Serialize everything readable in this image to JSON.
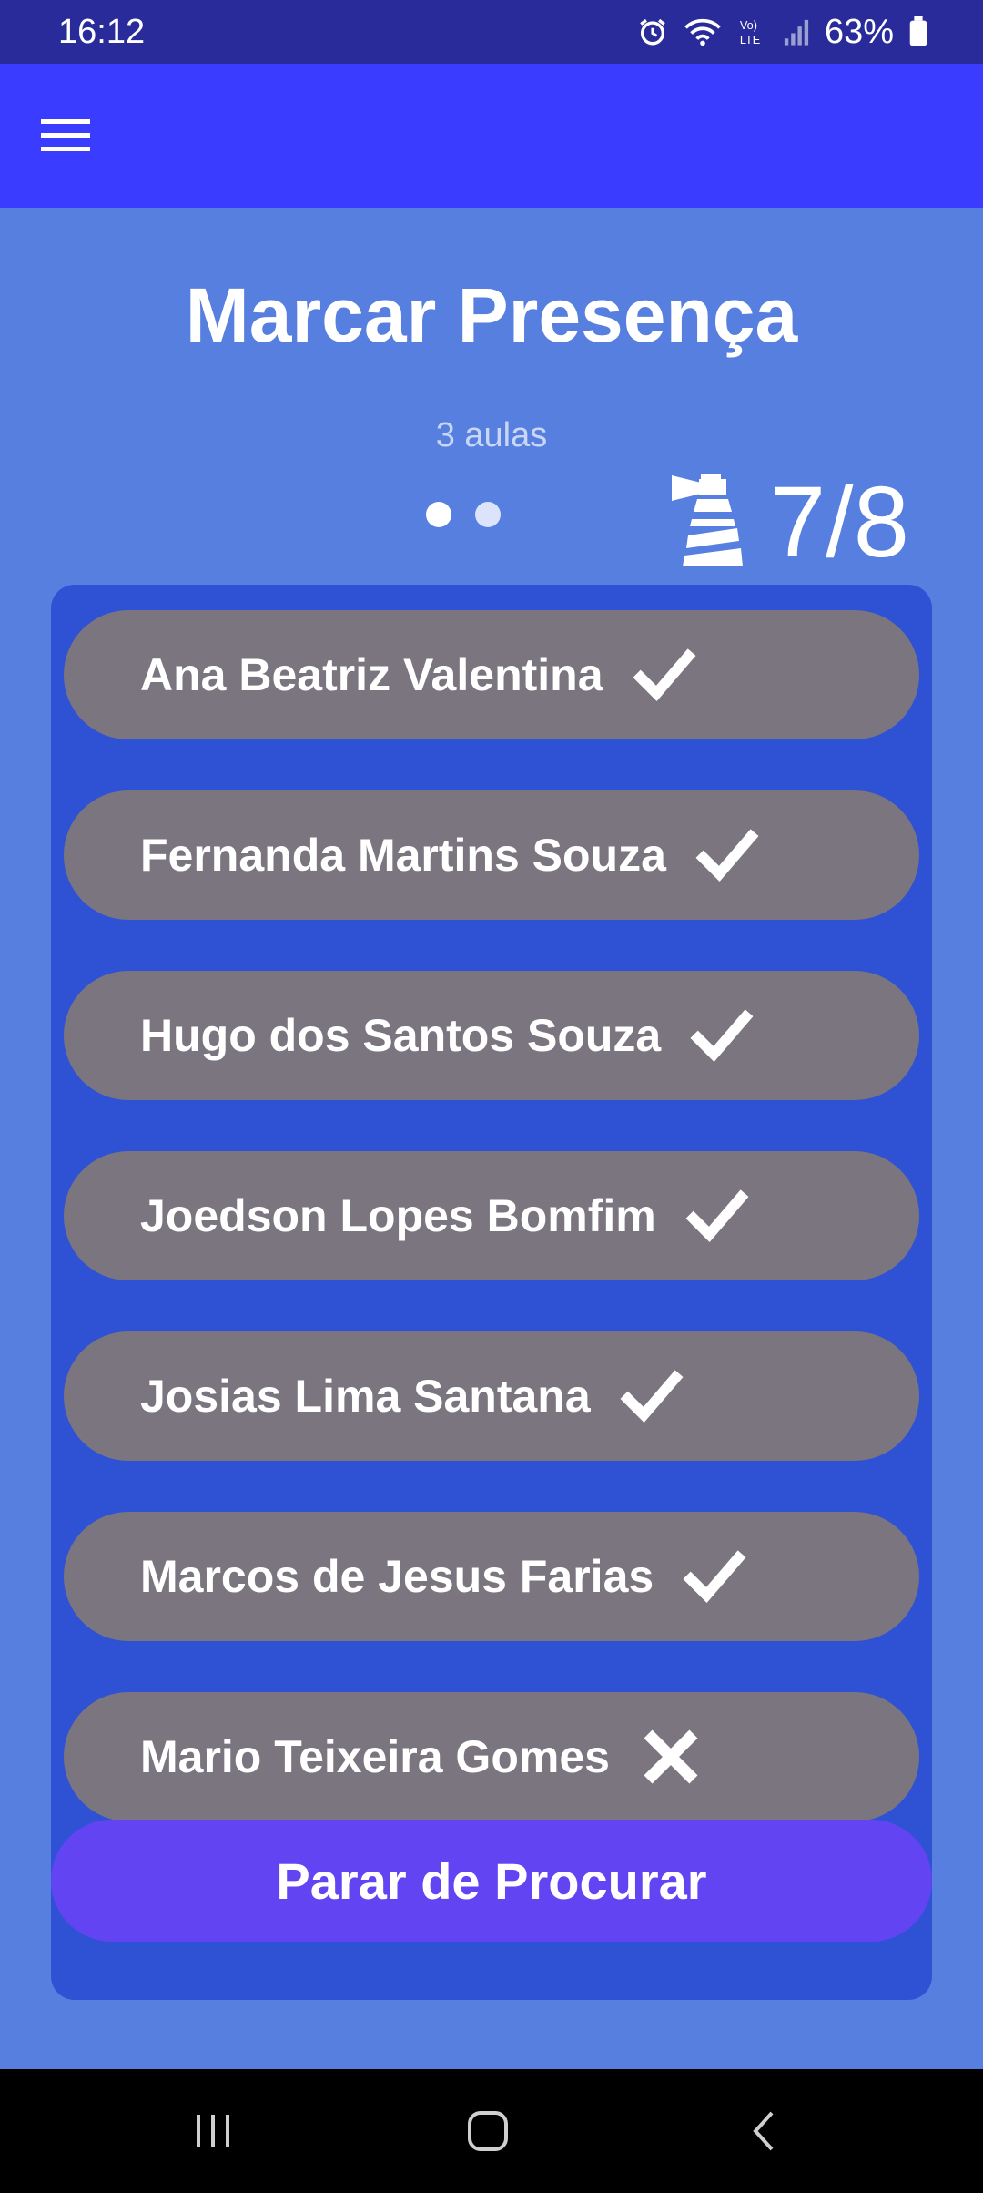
{
  "status_bar": {
    "time": "16:12",
    "battery": "63%",
    "network": "LTE",
    "icons": [
      "alarm-icon",
      "wifi-icon",
      "volte-icon",
      "signal-icon",
      "battery-icon"
    ]
  },
  "toolbar": {
    "menu_icon": "hamburger-menu-icon"
  },
  "main": {
    "title": "Marcar Presença",
    "classes": "3 aulas",
    "page_dots": 2,
    "count": "7/8",
    "beacon_icon": "lighthouse-icon"
  },
  "students": [
    {
      "name": "Ana Beatriz Valentina",
      "status": "present"
    },
    {
      "name": "Fernanda Martins Souza",
      "status": "present"
    },
    {
      "name": "Hugo dos Santos Souza",
      "status": "present"
    },
    {
      "name": "Joedson Lopes Bomfim",
      "status": "present"
    },
    {
      "name": "Josias Lima Santana",
      "status": "present"
    },
    {
      "name": "Marcos de Jesus Farias",
      "status": "present"
    },
    {
      "name": "Mario Teixeira Gomes",
      "status": "absent"
    }
  ],
  "stop_button": {
    "label": "Parar de Procurar"
  },
  "nav_bar": {
    "buttons": [
      "recent-apps-icon",
      "home-icon",
      "back-icon"
    ]
  },
  "colors": {
    "status_bar": "#2a2b9a",
    "toolbar": "#3a3dff",
    "background": "#577fdf",
    "list_panel": "#2f52d4",
    "row": "#7b7580",
    "button": "#6244f3"
  }
}
